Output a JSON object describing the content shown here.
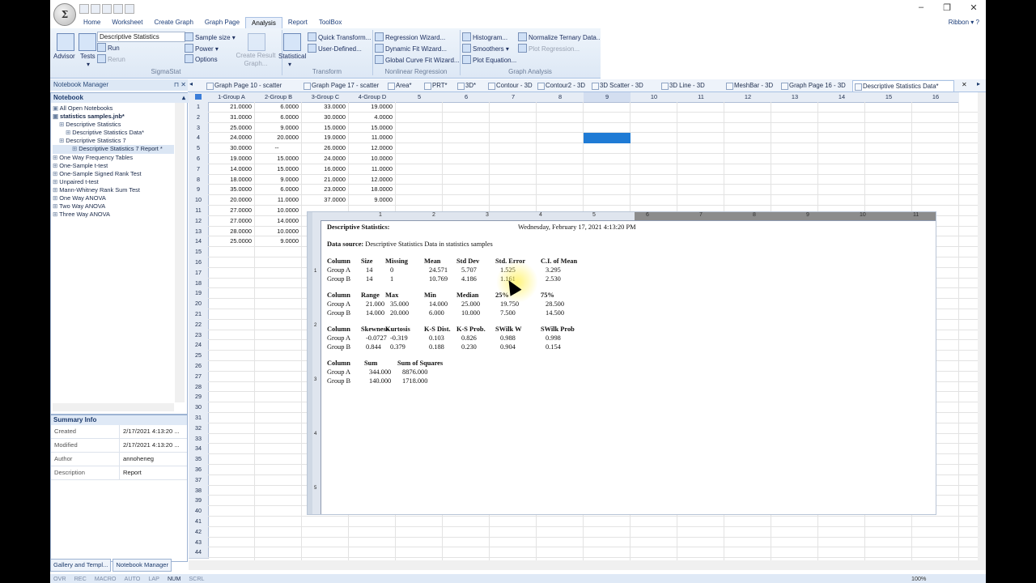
{
  "ribbon": {
    "tabs": [
      "Home",
      "Worksheet",
      "Create Graph",
      "Graph Page",
      "Analysis",
      "Report",
      "ToolBox"
    ],
    "active_tab": "Analysis",
    "ribbon_label": "Ribbon",
    "advisor": "Advisor",
    "tests": "Tests",
    "combo_value": "Descriptive Statistics",
    "run": "Run",
    "rerun": "Rerun",
    "sample_size": "Sample size",
    "power": "Power",
    "options": "Options",
    "create_result_graph": "Create Result Graph...",
    "statistical": "Statistical",
    "quick_transform": "Quick Transform...",
    "user_defined": "User-Defined...",
    "regression_wizard": "Regression Wizard...",
    "dynamic_fit_wizard": "Dynamic Fit Wizard...",
    "global_curve_fit_wizard": "Global Curve Fit Wizard...",
    "histogram": "Histogram...",
    "smoothers": "Smoothers",
    "plot_equation": "Plot Equation...",
    "normalize_ternary": "Normalize Ternary Data...",
    "plot_regression": "Plot Regression...",
    "group_sigmastat": "SigmaStat",
    "group_transform": "Transform",
    "group_nonlinear": "Nonlinear Regression",
    "group_graph_analysis": "Graph Analysis"
  },
  "notebook_manager": {
    "header": "Notebook Manager",
    "title": "Notebook",
    "tree": [
      {
        "label": "All Open Notebooks",
        "indent": 0,
        "bold": false,
        "sel": false
      },
      {
        "label": "statistics samples.jnb*",
        "indent": 0,
        "bold": true,
        "sel": false
      },
      {
        "label": "Descriptive Statistics",
        "indent": 1,
        "bold": false,
        "sel": false
      },
      {
        "label": "Descriptive Statistics Data*",
        "indent": 2,
        "bold": false,
        "sel": false
      },
      {
        "label": "Descriptive Statistics 7",
        "indent": 1,
        "bold": false,
        "sel": false
      },
      {
        "label": "Descriptive Statistics 7 Report *",
        "indent": 3,
        "bold": false,
        "sel": true
      },
      {
        "label": "One Way Frequency Tables",
        "indent": 0,
        "bold": false,
        "sel": false
      },
      {
        "label": "One-Sample t-test",
        "indent": 0,
        "bold": false,
        "sel": false
      },
      {
        "label": "One-Sample Signed Rank Test",
        "indent": 0,
        "bold": false,
        "sel": false
      },
      {
        "label": "Unpaired t-test",
        "indent": 0,
        "bold": false,
        "sel": false
      },
      {
        "label": "Mann-Whitney Rank Sum Test",
        "indent": 0,
        "bold": false,
        "sel": false
      },
      {
        "label": "One Way ANOVA",
        "indent": 0,
        "bold": false,
        "sel": false
      },
      {
        "label": "Two Way ANOVA",
        "indent": 0,
        "bold": false,
        "sel": false
      },
      {
        "label": "Three Way ANOVA",
        "indent": 0,
        "bold": false,
        "sel": false
      }
    ]
  },
  "summary": {
    "title": "Summary Info",
    "rows": [
      {
        "k": "Created",
        "v": "2/17/2021 4:13:20 ..."
      },
      {
        "k": "Modified",
        "v": "2/17/2021 4:13:20 ..."
      },
      {
        "k": "Author",
        "v": "annoheneg"
      },
      {
        "k": "Description",
        "v": "Report"
      }
    ]
  },
  "bottom_tabs": [
    "Gallery and Templ...",
    "Notebook Manager"
  ],
  "status": [
    "OVR",
    "REC",
    "MACRO",
    "AUTO",
    "LAP",
    "NUM",
    "SCRL"
  ],
  "zoom": "100%",
  "doc_tabs": [
    "Graph Page 10 - scatter",
    "Graph Page 17 - scatter",
    "Area*",
    "PRT*",
    "3D*",
    "Contour - 3D",
    "Contour2 - 3D",
    "3D Scatter - 3D",
    "3D Line - 3D",
    "MeshBar - 3D",
    "Graph Page 16 - 3D",
    "Descriptive Statistics Data*"
  ],
  "worksheet": {
    "columns": [
      "1-Group A",
      "2-Group B",
      "3-Group C",
      "4-Group D",
      "5",
      "6",
      "7",
      "8",
      "9",
      "10",
      "11",
      "12",
      "13",
      "14",
      "15",
      "16"
    ],
    "rows": [
      [
        "21.0000",
        "6.0000",
        "33.0000",
        "19.0000"
      ],
      [
        "31.0000",
        "6.0000",
        "30.0000",
        "4.0000"
      ],
      [
        "25.0000",
        "9.0000",
        "15.0000",
        "15.0000"
      ],
      [
        "24.0000",
        "20.0000",
        "19.0000",
        "11.0000"
      ],
      [
        "30.0000",
        "--",
        "26.0000",
        "12.0000"
      ],
      [
        "19.0000",
        "15.0000",
        "24.0000",
        "10.0000"
      ],
      [
        "14.0000",
        "15.0000",
        "16.0000",
        "11.0000"
      ],
      [
        "18.0000",
        "9.0000",
        "21.0000",
        "12.0000"
      ],
      [
        "35.0000",
        "6.0000",
        "23.0000",
        "18.0000"
      ],
      [
        "20.0000",
        "11.0000",
        "37.0000",
        "9.0000"
      ],
      [
        "27.0000",
        "10.0000",
        "",
        ""
      ],
      [
        "27.0000",
        "14.0000",
        "",
        ""
      ],
      [
        "28.0000",
        "10.0000",
        "",
        ""
      ],
      [
        "25.0000",
        "9.0000",
        "",
        ""
      ]
    ],
    "row_count": 44
  },
  "report": {
    "title": "Descriptive Statistics:",
    "datetime": "Wednesday, February 17, 2021 4:13:20 PM",
    "source_label": "Data source:",
    "source": "Descriptive Statistics Data in statistics samples",
    "ruler_top": [
      "1",
      "2",
      "3",
      "4",
      "5",
      "6",
      "7",
      "8",
      "9",
      "10",
      "11"
    ],
    "ruler_left": [
      "1",
      "2",
      "3",
      "4",
      "5"
    ],
    "table1": {
      "header": [
        "Column",
        "Size",
        "Missing",
        "Mean",
        "Std Dev",
        "Std. Error",
        "C.I. of Mean"
      ],
      "rows": [
        [
          "Group A",
          "14",
          "0",
          "24.571",
          "5.707",
          "1.525",
          "3.295"
        ],
        [
          "Group B",
          "14",
          "1",
          "10.769",
          "4.186",
          "1.161",
          "2.530"
        ]
      ]
    },
    "table2": {
      "header": [
        "Column",
        "Range",
        "Max",
        "Min",
        "Median",
        "25%",
        "75%"
      ],
      "rows": [
        [
          "Group A",
          "21.000",
          "35.000",
          "14.000",
          "25.000",
          "19.750",
          "28.500"
        ],
        [
          "Group B",
          "14.000",
          "20.000",
          "6.000",
          "10.000",
          "7.500",
          "14.500"
        ]
      ]
    },
    "table3": {
      "header": [
        "Column",
        "Skewness",
        "Kurtosis",
        "K-S Dist.",
        "K-S Prob.",
        "SWilk W",
        "SWilk Prob"
      ],
      "rows": [
        [
          "Group A",
          "-0.0727",
          "-0.319",
          "0.103",
          "0.826",
          "0.988",
          "0.998"
        ],
        [
          "Group B",
          "0.844",
          "0.379",
          "0.188",
          "0.230",
          "0.904",
          "0.154"
        ]
      ]
    },
    "table4": {
      "header": [
        "Column",
        "Sum",
        "Sum of Squares"
      ],
      "rows": [
        [
          "Group A",
          "344.000",
          "8876.000"
        ],
        [
          "Group B",
          "140.000",
          "1718.000"
        ]
      ]
    }
  }
}
